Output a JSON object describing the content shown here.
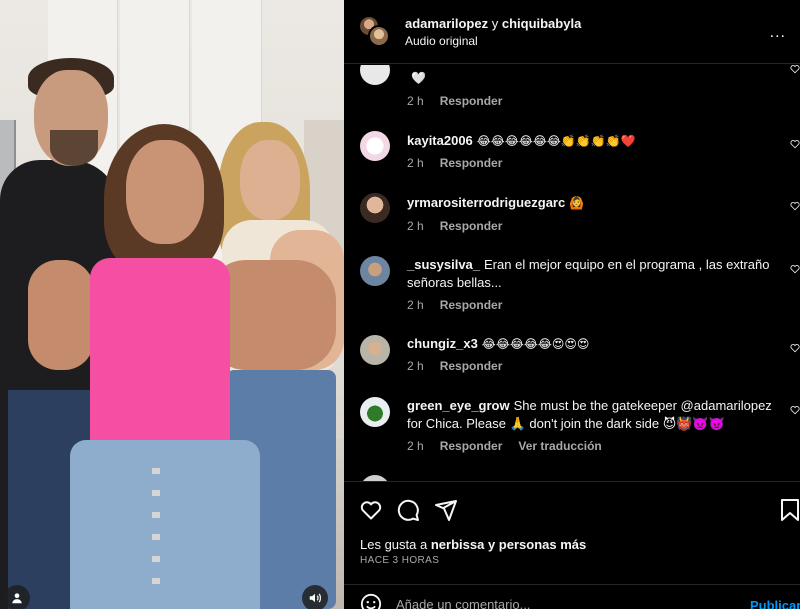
{
  "header": {
    "user1": "adamarilopez",
    "conjunction": "y",
    "user2": "chiquibabyla",
    "subtitle": "Audio original",
    "more": "..."
  },
  "comments": [
    {
      "username": "",
      "text": "🤍",
      "time": "2 h",
      "reply": "Responder",
      "translate": ""
    },
    {
      "username": "kayita2006",
      "text": "😂😂😂😂😂😂👏👏👏👏❤️",
      "time": "2 h",
      "reply": "Responder",
      "translate": ""
    },
    {
      "username": "yrmarositerrodriguezgarc",
      "text": "🙆",
      "time": "2 h",
      "reply": "Responder",
      "translate": ""
    },
    {
      "username": "_susysilva_",
      "text": "Eran el mejor equipo en el programa , las extraño señoras bellas...",
      "time": "2 h",
      "reply": "Responder",
      "translate": ""
    },
    {
      "username": "chungiz_x3",
      "text": "😂😂😂😂😂😍😍😍",
      "time": "2 h",
      "reply": "Responder",
      "translate": ""
    },
    {
      "username": "green_eye_grow",
      "text": "She must be the gatekeeper @adamarilopez for Chica. Please 🙏 don't join the dark side 😈👹👿👿",
      "time": "2 h",
      "reply": "Responder",
      "translate": "Ver traducción"
    }
  ],
  "likes": {
    "prefix": "Les gusta a",
    "user": "nerbissa",
    "suffix": "y personas más"
  },
  "time_ago": "HACE 3 HORAS",
  "comment_input": {
    "placeholder": "Añade un comentario..."
  },
  "publish_label": "Publicar",
  "icons": {
    "like": "heart-icon",
    "comment": "comment-icon",
    "share": "send-icon",
    "save": "bookmark-icon",
    "emoji": "smile-icon",
    "mute": "speaker-icon",
    "tags": "user-icon"
  },
  "colors": {
    "background": "#000000",
    "text": "#f5f5f5",
    "muted": "#a8a8a8",
    "accent": "#0095f6"
  }
}
